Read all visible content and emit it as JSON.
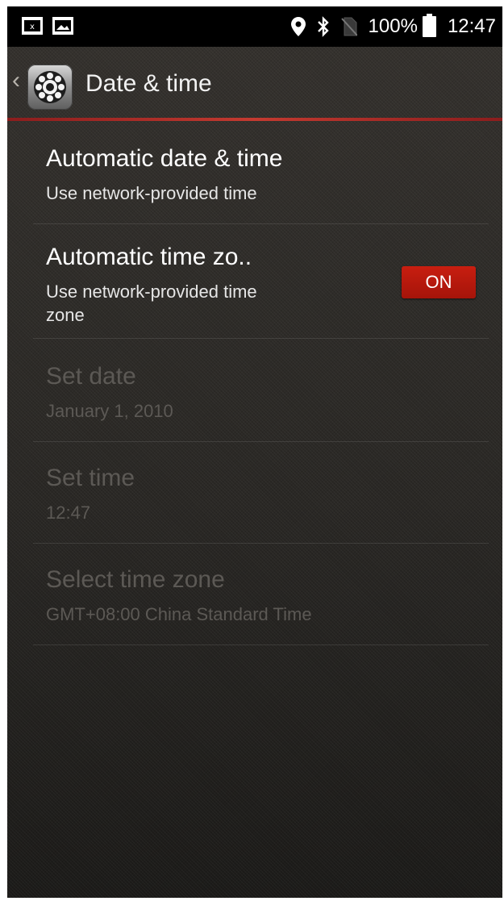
{
  "status_bar": {
    "battery_percent": "100%",
    "time": "12:47",
    "icons": [
      "debug-notification-icon",
      "image-notification-icon",
      "location-icon",
      "bluetooth-icon",
      "no-sim-icon",
      "battery-icon"
    ]
  },
  "action_bar": {
    "title": "Date & time",
    "app_icon": "settings-gear-icon",
    "back_icon": "chevron-left-icon"
  },
  "settings": [
    {
      "title": "Automatic date & time",
      "summary": "Use network-provided time"
    },
    {
      "title": "Automatic time zo..",
      "summary": "Use network-provided time zone",
      "toggle": "ON"
    },
    {
      "title": "Set date",
      "summary": "January 1, 2010"
    },
    {
      "title": "Set time",
      "summary": "12:47"
    },
    {
      "title": "Select time zone",
      "summary": "GMT+08:00 China Standard Time"
    }
  ],
  "colors": {
    "accent": "#c43a30",
    "toggle_on": "#b8180c",
    "background": "#2b2926"
  }
}
